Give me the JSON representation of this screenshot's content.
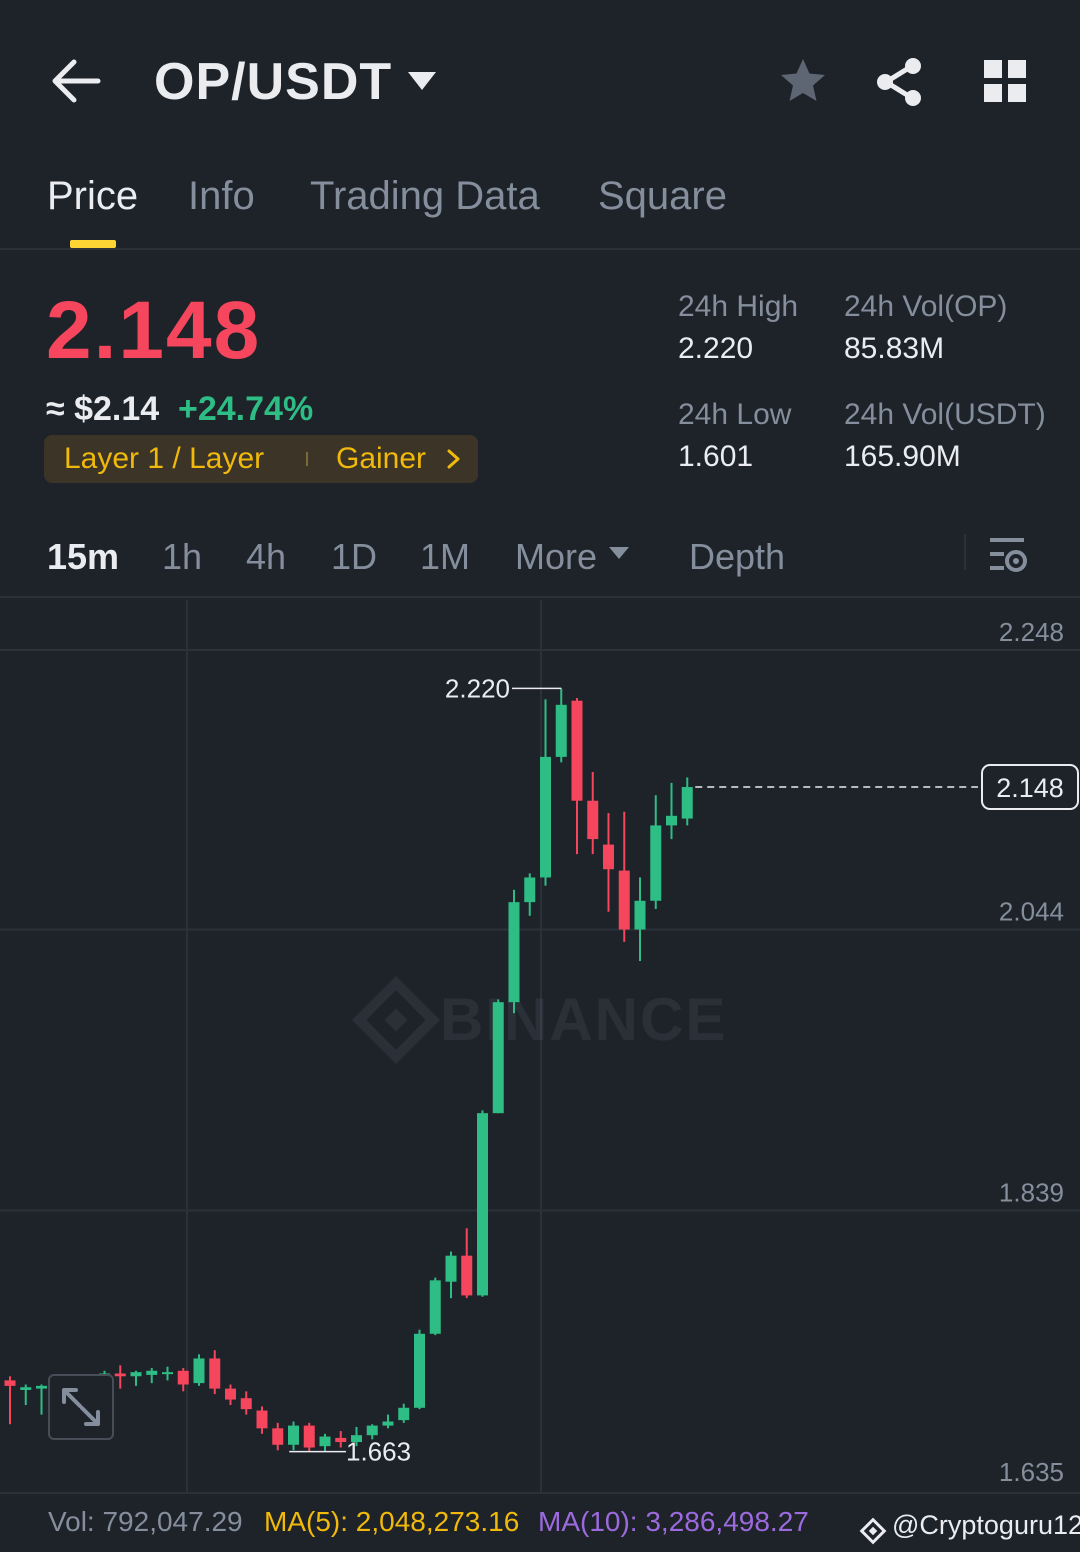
{
  "header": {
    "pair": "OP/USDT",
    "icons": [
      "back-arrow-icon",
      "caret-down-icon",
      "star-icon",
      "share-icon",
      "grid-icon"
    ]
  },
  "tabs": [
    {
      "label": "Price",
      "active": true
    },
    {
      "label": "Info",
      "active": false
    },
    {
      "label": "Trading Data",
      "active": false
    },
    {
      "label": "Square",
      "active": false
    }
  ],
  "ticker": {
    "last_price": "2.148",
    "approx_usd": "≈ $2.14",
    "change_pct": "+24.74%",
    "tag_left": "Layer 1 / Layer",
    "tag_right": "Gainer"
  },
  "stats": {
    "high_label": "24h High",
    "high_value": "2.220",
    "low_label": "24h Low",
    "low_value": "1.601",
    "vol_op_label": "24h Vol(OP)",
    "vol_op_value": "85.83M",
    "vol_usdt_label": "24h Vol(USDT)",
    "vol_usdt_value": "165.90M"
  },
  "intervals": {
    "items": [
      {
        "label": "15m",
        "active": true
      },
      {
        "label": "1h",
        "active": false
      },
      {
        "label": "4h",
        "active": false
      },
      {
        "label": "1D",
        "active": false
      },
      {
        "label": "1M",
        "active": false
      }
    ],
    "more_label": "More",
    "depth_label": "Depth"
  },
  "chart_data": {
    "type": "candlestick",
    "price_axis_labels": [
      "2.248",
      "2.044",
      "1.839",
      "1.635"
    ],
    "ylim": [
      1.635,
      2.248
    ],
    "current_price_label": "2.148",
    "high_marker_label": "2.220",
    "low_marker_label": "1.663",
    "watermark": "BINANCE",
    "colors": {
      "up": "#2ebd85",
      "down": "#f6465d"
    },
    "candles": [
      {
        "o": 1.715,
        "h": 1.718,
        "c": 1.711,
        "l": 1.683
      },
      {
        "o": 1.708,
        "h": 1.712,
        "c": 1.71,
        "l": 1.697
      },
      {
        "o": 1.709,
        "h": 1.712,
        "c": 1.711,
        "l": 1.69
      },
      {
        "o": 1.709,
        "h": 1.712,
        "c": 1.711,
        "l": 1.681
      },
      {
        "o": 1.714,
        "h": 1.717,
        "c": 1.712,
        "l": 1.702
      },
      {
        "o": 1.712,
        "h": 1.716,
        "c": 1.713,
        "l": 1.707
      },
      {
        "o": 1.717,
        "h": 1.722,
        "c": 1.72,
        "l": 1.712
      },
      {
        "o": 1.72,
        "h": 1.726,
        "c": 1.718,
        "l": 1.709
      },
      {
        "o": 1.718,
        "h": 1.722,
        "c": 1.721,
        "l": 1.711
      },
      {
        "o": 1.719,
        "h": 1.724,
        "c": 1.722,
        "l": 1.713
      },
      {
        "o": 1.72,
        "h": 1.725,
        "c": 1.721,
        "l": 1.715
      },
      {
        "o": 1.722,
        "h": 1.724,
        "c": 1.712,
        "l": 1.707
      },
      {
        "o": 1.713,
        "h": 1.734,
        "c": 1.731,
        "l": 1.711
      },
      {
        "o": 1.731,
        "h": 1.737,
        "c": 1.709,
        "l": 1.705
      },
      {
        "o": 1.709,
        "h": 1.712,
        "c": 1.701,
        "l": 1.697
      },
      {
        "o": 1.702,
        "h": 1.707,
        "c": 1.694,
        "l": 1.69
      },
      {
        "o": 1.693,
        "h": 1.696,
        "c": 1.68,
        "l": 1.676
      },
      {
        "o": 1.68,
        "h": 1.684,
        "c": 1.668,
        "l": 1.664
      },
      {
        "o": 1.668,
        "h": 1.685,
        "c": 1.682,
        "l": 1.664
      },
      {
        "o": 1.682,
        "h": 1.684,
        "c": 1.666,
        "l": 1.663
      },
      {
        "o": 1.667,
        "h": 1.676,
        "c": 1.674,
        "l": 1.663
      },
      {
        "o": 1.673,
        "h": 1.678,
        "c": 1.67,
        "l": 1.666
      },
      {
        "o": 1.67,
        "h": 1.681,
        "c": 1.675,
        "l": 1.667
      },
      {
        "o": 1.675,
        "h": 1.683,
        "c": 1.682,
        "l": 1.672
      },
      {
        "o": 1.682,
        "h": 1.69,
        "c": 1.685,
        "l": 1.68
      },
      {
        "o": 1.686,
        "h": 1.698,
        "c": 1.695,
        "l": 1.684
      },
      {
        "o": 1.695,
        "h": 1.752,
        "c": 1.749,
        "l": 1.694
      },
      {
        "o": 1.749,
        "h": 1.79,
        "c": 1.788,
        "l": 1.748
      },
      {
        "o": 1.787,
        "h": 1.809,
        "c": 1.806,
        "l": 1.775
      },
      {
        "o": 1.806,
        "h": 1.826,
        "c": 1.777,
        "l": 1.775
      },
      {
        "o": 1.777,
        "h": 1.912,
        "c": 1.91,
        "l": 1.776
      },
      {
        "o": 1.91,
        "h": 1.993,
        "c": 1.991,
        "l": 1.91
      },
      {
        "o": 1.991,
        "h": 2.073,
        "c": 2.064,
        "l": 1.983
      },
      {
        "o": 2.064,
        "h": 2.085,
        "c": 2.082,
        "l": 2.054
      },
      {
        "o": 2.082,
        "h": 2.212,
        "c": 2.17,
        "l": 2.076
      },
      {
        "o": 2.17,
        "h": 2.22,
        "c": 2.208,
        "l": 2.166
      },
      {
        "o": 2.211,
        "h": 2.213,
        "c": 2.138,
        "l": 2.099
      },
      {
        "o": 2.138,
        "h": 2.159,
        "c": 2.11,
        "l": 2.099
      },
      {
        "o": 2.106,
        "h": 2.129,
        "c": 2.088,
        "l": 2.057
      },
      {
        "o": 2.087,
        "h": 2.13,
        "c": 2.044,
        "l": 2.035
      },
      {
        "o": 2.044,
        "h": 2.082,
        "c": 2.065,
        "l": 2.021
      },
      {
        "o": 2.065,
        "h": 2.142,
        "c": 2.12,
        "l": 2.059
      },
      {
        "o": 2.12,
        "h": 2.151,
        "c": 2.127,
        "l": 2.11
      },
      {
        "o": 2.125,
        "h": 2.155,
        "c": 2.148,
        "l": 2.12
      }
    ]
  },
  "footer": {
    "vol": "Vol: 792,047.29",
    "ma5": "MA(5): 2,048,273.16",
    "ma10": "MA(10): 3,286,498.27",
    "watermark_user": "@Cryptoguru12",
    "colors": {
      "vol": "#848e9c",
      "ma5": "#f0b90b",
      "ma10": "#9c6ade"
    }
  }
}
